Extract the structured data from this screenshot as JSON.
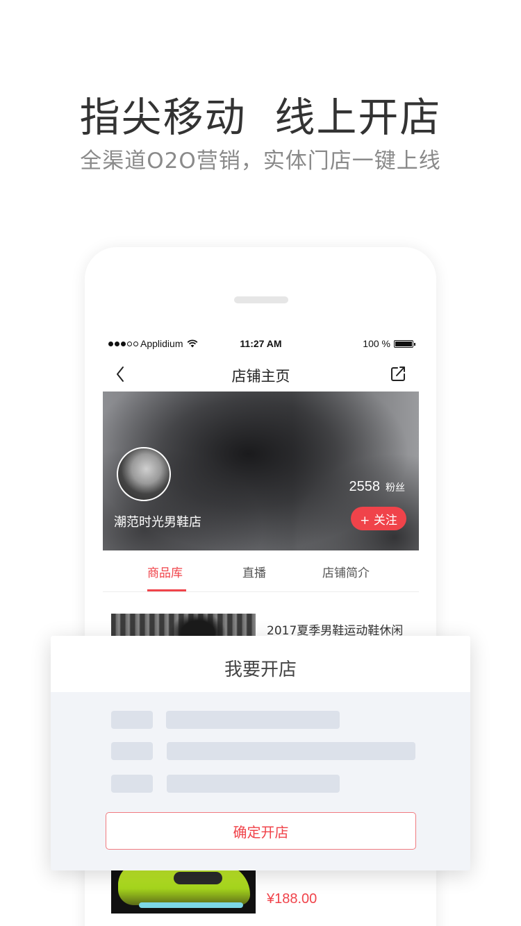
{
  "hero": {
    "headline": "指尖移动  线上开店",
    "subline": "全渠道O2O营销，实体门店一键上线"
  },
  "status_bar": {
    "carrier": "Applidium",
    "time": "11:27 AM",
    "battery": "100 %",
    "signal_dots_filled": 3,
    "signal_dots_total": 5
  },
  "nav": {
    "back_icon": "chevron-left-icon",
    "title": "店铺主页",
    "share_icon": "share-icon"
  },
  "store": {
    "name": "潮范时光男鞋店",
    "fans_count": "2558",
    "fans_label": "粉丝",
    "follow_label": "+ 关注"
  },
  "tabs": [
    {
      "label": "商品库",
      "active": true
    },
    {
      "label": "直播",
      "active": false
    },
    {
      "label": "店铺简介",
      "active": false
    }
  ],
  "products": [
    {
      "title": "2017夏季男鞋运动鞋休闲"
    },
    {
      "price": "¥188.00"
    }
  ],
  "modal": {
    "title": "我要开店",
    "confirm_label": "确定开店"
  },
  "colors": {
    "accent": "#f0434a",
    "headline_text": "#333333",
    "subline_text": "#8a8a8a",
    "placeholder": "#dce1ea",
    "modal_bg": "#f2f4f8"
  }
}
